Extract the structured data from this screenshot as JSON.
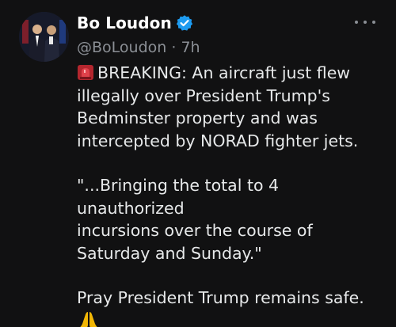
{
  "author": {
    "name": "Bo Loudon",
    "handle": "@BoLoudon",
    "separator": " · ",
    "time": "7h",
    "verified_color": "#1d9bf0",
    "avatar_icon": "profile-photo"
  },
  "more_icon": "more-horizontal-icon",
  "tweet": {
    "line1": "BREAKING: An aircraft just flew",
    "line2": "illegally over President Trump's",
    "line3": "Bedminster property and was",
    "line4": "intercepted by NORAD fighter jets.",
    "quote1": "\"...Bringing the total to 4 unauthorized",
    "quote2": "incursions over the course of",
    "quote3": "Saturday and Sunday.\"",
    "closing": "Pray President Trump remains safe.",
    "lead_emoji": "rotating-light-icon",
    "end_emoji": "folded-hands-icon"
  }
}
